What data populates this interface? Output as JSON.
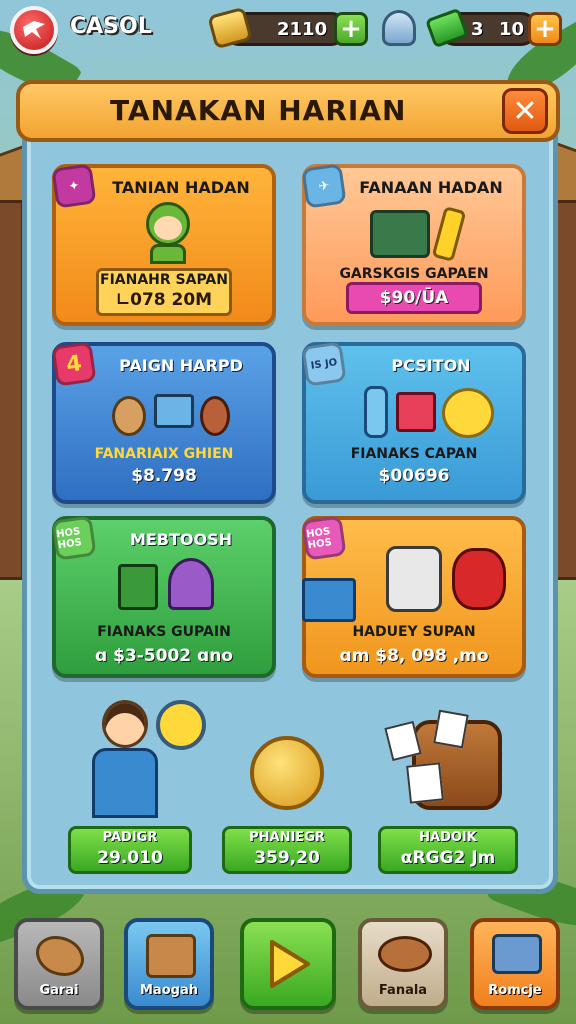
{
  "header": {
    "logo_text": "CASOL",
    "currency1_value": "2110",
    "currency2_value": "3",
    "currency3_value": "10"
  },
  "panel": {
    "title": "TANAKAN HARIAN"
  },
  "offers": [
    {
      "badge": "",
      "title": "TANIAN HADAN",
      "subtitle": "FIANAHR SAPAN",
      "price": "∟078 20M"
    },
    {
      "badge": "",
      "title": "FANAAN HADAN",
      "subtitle": "GARSKGIS GAPAEN",
      "price": "$90/ŪA"
    },
    {
      "badge": "4",
      "title": "PAIGN HARPD",
      "subtitle": "FANARIAIX GHIEN",
      "price": "$8.798"
    },
    {
      "badge": "IS JO",
      "title": "PCSITON",
      "subtitle": "FIANAKS CAPAN",
      "price": "$00696"
    },
    {
      "badge": "HOS HOS",
      "title": "MEBTOOSH",
      "subtitle": "FIANAKS GUPAIN",
      "price": "ɑ $3-5002 ɑno"
    },
    {
      "badge": "HOS HOS",
      "title": "",
      "subtitle": "HADUEY SUPAN",
      "price": "ɑm $8, 098 ,mo"
    }
  ],
  "rewards": [
    {
      "label": "PADIGR",
      "value": "29.010"
    },
    {
      "label": "PHANIEGR",
      "value": "359,20"
    },
    {
      "label": "HADOIK",
      "value": "αRGG2 Jm"
    }
  ],
  "nav": [
    {
      "label": "Garai"
    },
    {
      "label": "Maogah"
    },
    {
      "label": ""
    },
    {
      "label": "Fanala"
    },
    {
      "label": "Romcje"
    }
  ]
}
